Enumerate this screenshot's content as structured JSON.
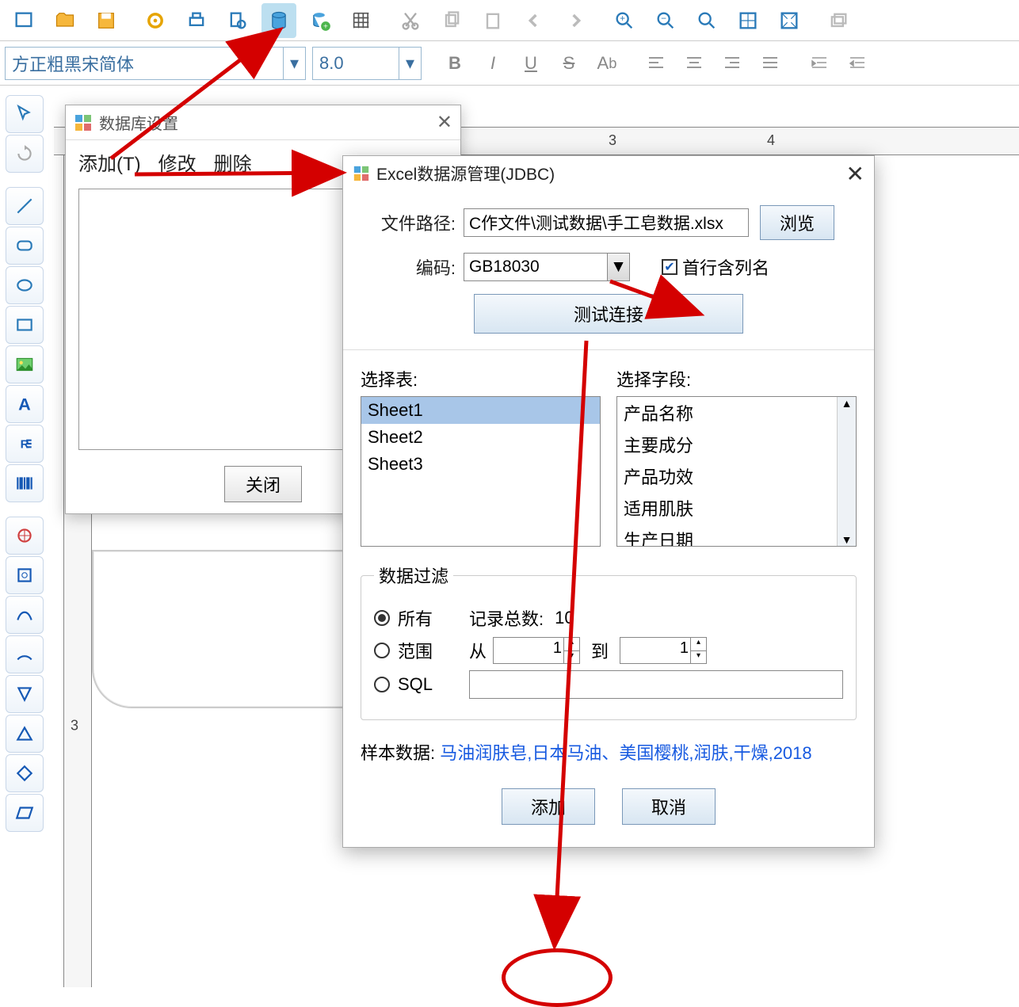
{
  "formatbar": {
    "font": "方正粗黑宋简体",
    "size": "8.0"
  },
  "ruler": {
    "h3": "3",
    "h4": "4",
    "v3": "3"
  },
  "dlg1": {
    "title": "数据库设置",
    "menu_add": "添加(T)",
    "menu_edit": "修改",
    "menu_delete": "删除",
    "close_btn": "关闭"
  },
  "dlg2": {
    "title": "Excel数据源管理(JDBC)",
    "filepath_label": "文件路径:",
    "filepath_value": "C作文件\\测试数据\\手工皂数据.xlsx",
    "browse": "浏览",
    "encoding_label": "编码:",
    "encoding_value": "GB18030",
    "first_row_header": "首行含列名",
    "test_conn": "测试连接",
    "select_table": "选择表:",
    "select_field": "选择字段:",
    "tables": [
      "Sheet1",
      "Sheet2",
      "Sheet3"
    ],
    "fields": [
      "产品名称",
      "主要成分",
      "产品功效",
      "适用肌肤",
      "生产日期"
    ],
    "filter_legend": "数据过滤",
    "filter_all": "所有",
    "filter_range": "范围",
    "filter_sql": "SQL",
    "record_count_label": "记录总数:",
    "record_count": "10",
    "from_label": "从",
    "to_label": "到",
    "from_val": "1",
    "to_val": "1",
    "sample_label": "样本数据:",
    "sample_value": "马油润肤皂,日本马油、美国樱桃,润肤,干燥,2018",
    "ok": "添加",
    "cancel": "取消"
  }
}
